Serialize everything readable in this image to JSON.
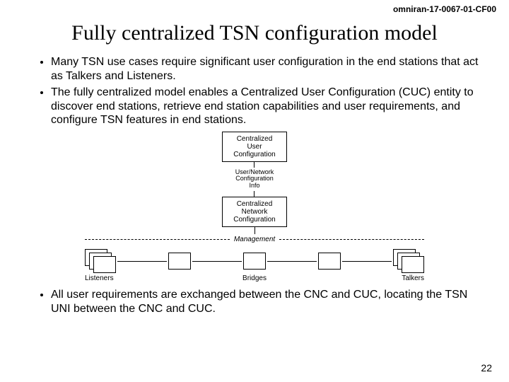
{
  "doc_id": "omniran-17-0067-01-CF00",
  "title": "Fully centralized TSN configuration model",
  "bullets_top": [
    "Many TSN use cases require significant user configuration in the end stations that act as Talkers and Listeners.",
    "The fully centralized model enables a Centralized User Configuration (CUC) entity to discover end stations, retrieve end station capabilities and user requirements, and configure TSN features in end stations."
  ],
  "diagram": {
    "cuc_label": "Centralized\nUser\nConfiguration",
    "link_label": "User/Network\nConfiguration\nInfo",
    "cnc_label": "Centralized\nNetwork\nConfiguration",
    "management_label": "Management",
    "listeners_label": "Listeners",
    "bridges_label": "Bridges",
    "talkers_label": "Talkers"
  },
  "bullets_bottom": [
    "All user requirements are exchanged between the CNC and CUC, locating the TSN UNI between the CNC and CUC."
  ],
  "page_number": "22"
}
